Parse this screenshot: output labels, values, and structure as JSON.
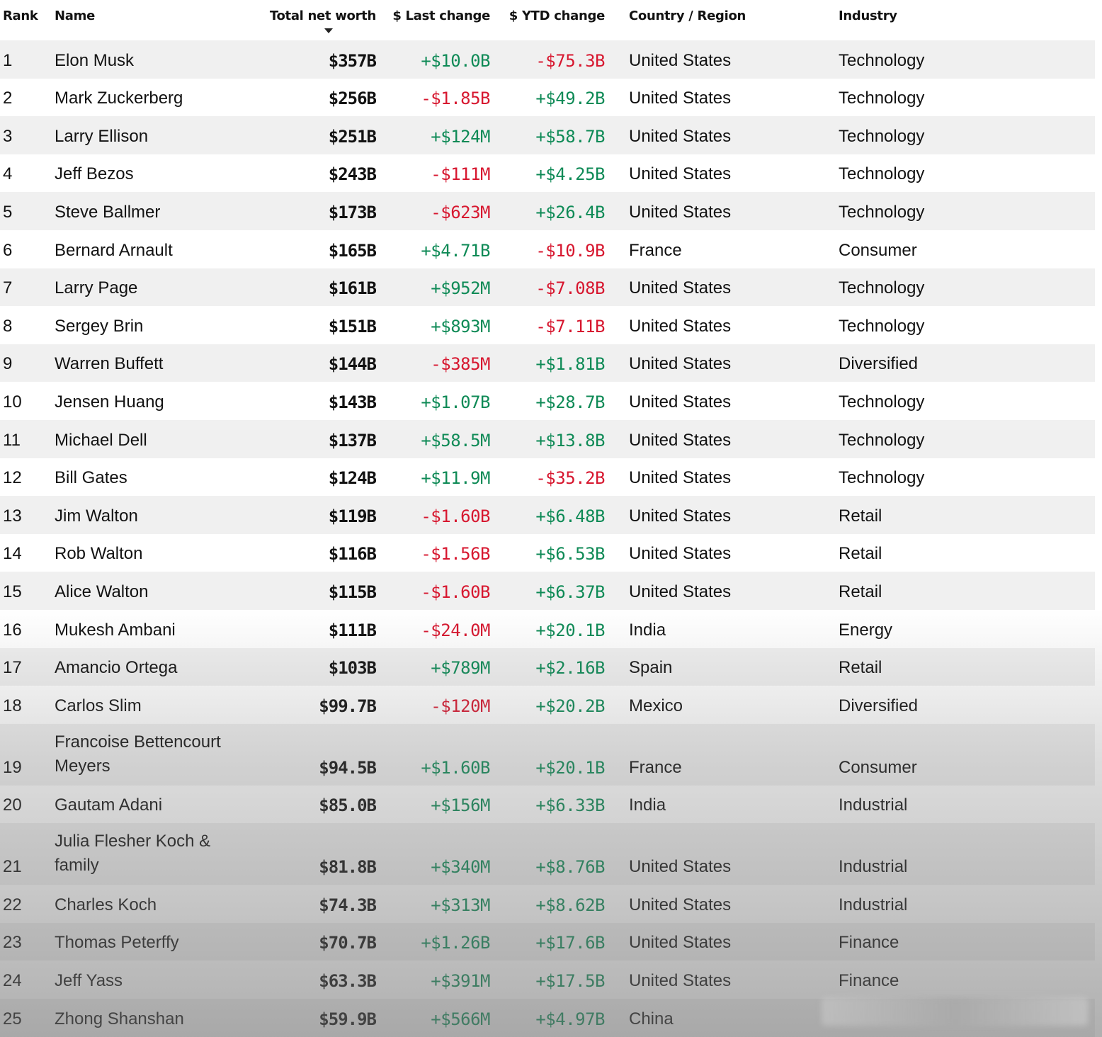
{
  "headers": {
    "rank": "Rank",
    "name": "Name",
    "worth": "Total net worth",
    "last": "$ Last change",
    "ytd": "$ YTD change",
    "country": "Country / Region",
    "industry": "Industry"
  },
  "sort": {
    "column": "Total net worth",
    "direction": "descending",
    "icon": "caret-down-icon"
  },
  "colors": {
    "positive": "#0e8a56",
    "negative": "#d7172f",
    "stripe": "#f0f0f0"
  },
  "rows": [
    {
      "rank": "1",
      "name": "Elon Musk",
      "worth": "$357B",
      "last": "+$10.0B",
      "ytd": "-$75.3B",
      "country": "United States",
      "industry": "Technology"
    },
    {
      "rank": "2",
      "name": "Mark Zuckerberg",
      "worth": "$256B",
      "last": "-$1.85B",
      "ytd": "+$49.2B",
      "country": "United States",
      "industry": "Technology"
    },
    {
      "rank": "3",
      "name": "Larry Ellison",
      "worth": "$251B",
      "last": "+$124M",
      "ytd": "+$58.7B",
      "country": "United States",
      "industry": "Technology"
    },
    {
      "rank": "4",
      "name": "Jeff Bezos",
      "worth": "$243B",
      "last": "-$111M",
      "ytd": "+$4.25B",
      "country": "United States",
      "industry": "Technology"
    },
    {
      "rank": "5",
      "name": "Steve Ballmer",
      "worth": "$173B",
      "last": "-$623M",
      "ytd": "+$26.4B",
      "country": "United States",
      "industry": "Technology"
    },
    {
      "rank": "6",
      "name": "Bernard Arnault",
      "worth": "$165B",
      "last": "+$4.71B",
      "ytd": "-$10.9B",
      "country": "France",
      "industry": "Consumer"
    },
    {
      "rank": "7",
      "name": "Larry Page",
      "worth": "$161B",
      "last": "+$952M",
      "ytd": "-$7.08B",
      "country": "United States",
      "industry": "Technology"
    },
    {
      "rank": "8",
      "name": "Sergey Brin",
      "worth": "$151B",
      "last": "+$893M",
      "ytd": "-$7.11B",
      "country": "United States",
      "industry": "Technology"
    },
    {
      "rank": "9",
      "name": "Warren Buffett",
      "worth": "$144B",
      "last": "-$385M",
      "ytd": "+$1.81B",
      "country": "United States",
      "industry": "Diversified"
    },
    {
      "rank": "10",
      "name": "Jensen Huang",
      "worth": "$143B",
      "last": "+$1.07B",
      "ytd": "+$28.7B",
      "country": "United States",
      "industry": "Technology"
    },
    {
      "rank": "11",
      "name": "Michael Dell",
      "worth": "$137B",
      "last": "+$58.5M",
      "ytd": "+$13.8B",
      "country": "United States",
      "industry": "Technology"
    },
    {
      "rank": "12",
      "name": "Bill Gates",
      "worth": "$124B",
      "last": "+$11.9M",
      "ytd": "-$35.2B",
      "country": "United States",
      "industry": "Technology"
    },
    {
      "rank": "13",
      "name": "Jim Walton",
      "worth": "$119B",
      "last": "-$1.60B",
      "ytd": "+$6.48B",
      "country": "United States",
      "industry": "Retail"
    },
    {
      "rank": "14",
      "name": "Rob Walton",
      "worth": "$116B",
      "last": "-$1.56B",
      "ytd": "+$6.53B",
      "country": "United States",
      "industry": "Retail"
    },
    {
      "rank": "15",
      "name": "Alice Walton",
      "worth": "$115B",
      "last": "-$1.60B",
      "ytd": "+$6.37B",
      "country": "United States",
      "industry": "Retail"
    },
    {
      "rank": "16",
      "name": "Mukesh Ambani",
      "worth": "$111B",
      "last": "-$24.0M",
      "ytd": "+$20.1B",
      "country": "India",
      "industry": "Energy"
    },
    {
      "rank": "17",
      "name": "Amancio Ortega",
      "worth": "$103B",
      "last": "+$789M",
      "ytd": "+$2.16B",
      "country": "Spain",
      "industry": "Retail"
    },
    {
      "rank": "18",
      "name": "Carlos Slim",
      "worth": "$99.7B",
      "last": "-$120M",
      "ytd": "+$20.2B",
      "country": "Mexico",
      "industry": "Diversified"
    },
    {
      "rank": "19",
      "name": "Francoise Bettencourt Meyers",
      "worth": "$94.5B",
      "last": "+$1.60B",
      "ytd": "+$20.1B",
      "country": "France",
      "industry": "Consumer"
    },
    {
      "rank": "20",
      "name": "Gautam Adani",
      "worth": "$85.0B",
      "last": "+$156M",
      "ytd": "+$6.33B",
      "country": "India",
      "industry": "Industrial"
    },
    {
      "rank": "21",
      "name": "Julia Flesher Koch & family",
      "worth": "$81.8B",
      "last": "+$340M",
      "ytd": "+$8.76B",
      "country": "United States",
      "industry": "Industrial"
    },
    {
      "rank": "22",
      "name": "Charles Koch",
      "worth": "$74.3B",
      "last": "+$313M",
      "ytd": "+$8.62B",
      "country": "United States",
      "industry": "Industrial"
    },
    {
      "rank": "23",
      "name": "Thomas Peterffy",
      "worth": "$70.7B",
      "last": "+$1.26B",
      "ytd": "+$17.6B",
      "country": "United States",
      "industry": "Finance"
    },
    {
      "rank": "24",
      "name": "Jeff Yass",
      "worth": "$63.3B",
      "last": "+$391M",
      "ytd": "+$17.5B",
      "country": "United States",
      "industry": "Finance"
    },
    {
      "rank": "25",
      "name": "Zhong Shanshan",
      "worth": "$59.9B",
      "last": "+$566M",
      "ytd": "+$4.97B",
      "country": "China",
      "industry": ""
    }
  ]
}
